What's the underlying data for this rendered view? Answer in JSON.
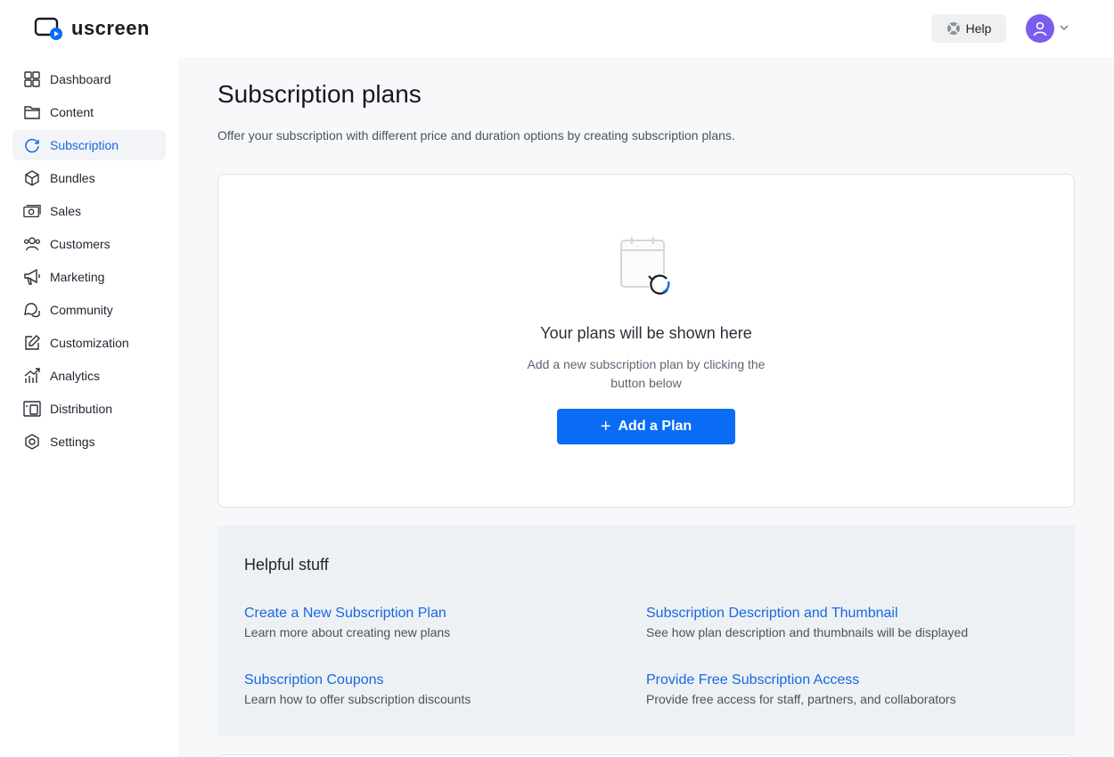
{
  "app": {
    "name": "uscreen"
  },
  "header": {
    "help_label": "Help"
  },
  "sidebar": {
    "items": [
      {
        "label": "Dashboard",
        "icon": "dashboard-icon"
      },
      {
        "label": "Content",
        "icon": "folder-icon"
      },
      {
        "label": "Subscription",
        "icon": "subscription-icon",
        "active": true
      },
      {
        "label": "Bundles",
        "icon": "box-icon"
      },
      {
        "label": "Sales",
        "icon": "money-icon"
      },
      {
        "label": "Customers",
        "icon": "users-icon"
      },
      {
        "label": "Marketing",
        "icon": "megaphone-icon"
      },
      {
        "label": "Community",
        "icon": "chat-icon"
      },
      {
        "label": "Customization",
        "icon": "edit-icon"
      },
      {
        "label": "Analytics",
        "icon": "chart-icon"
      },
      {
        "label": "Distribution",
        "icon": "devices-icon"
      },
      {
        "label": "Settings",
        "icon": "gear-icon"
      }
    ]
  },
  "page": {
    "title": "Subscription plans",
    "description": "Offer your subscription with different price and duration options by creating subscription plans."
  },
  "empty_state": {
    "title": "Your plans will be shown here",
    "subtitle": "Add a new subscription plan by clicking the button below",
    "button_label": "Add a Plan"
  },
  "helpful": {
    "title": "Helpful stuff",
    "links": [
      {
        "title": "Create a New Subscription Plan",
        "desc": "Learn more about creating new plans"
      },
      {
        "title": "Subscription Description and Thumbnail",
        "desc": "See how plan description and thumbnails will be displayed"
      },
      {
        "title": "Subscription Coupons",
        "desc": "Learn how to offer subscription discounts"
      },
      {
        "title": "Provide Free Subscription Access",
        "desc": "Provide free access for staff, partners, and collaborators"
      }
    ]
  },
  "colors": {
    "accent": "#0a6cf5",
    "link": "#1668e3",
    "avatar": "#7b5cf0"
  }
}
